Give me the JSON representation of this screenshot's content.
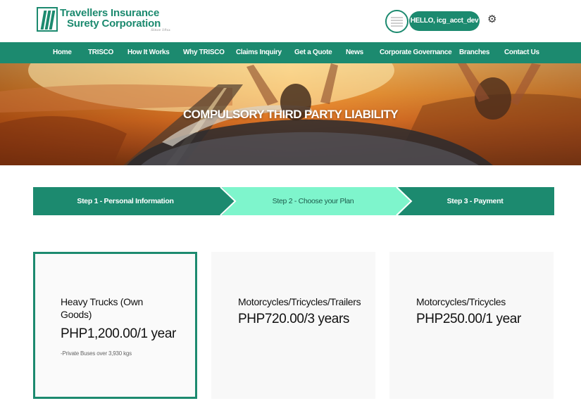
{
  "brand": {
    "name_line1": "Travellers Insurance",
    "name_line2": "Surety Corporation",
    "tagline": "Since 19xx"
  },
  "user": {
    "greeting": "HELLO, icg_acct_dev",
    "settings_icon": "gear-icon"
  },
  "nav": {
    "items": [
      "Home",
      "TRISCO",
      "How It Works",
      "Why TRISCO",
      "Claims Inquiry",
      "Get a Quote",
      "News",
      "Corporate Governance",
      "Branches",
      "Contact Us"
    ]
  },
  "hero": {
    "title": "COMPULSORY THIRD PARTY LIABILITY"
  },
  "steps": [
    {
      "label": "Step 1 - Personal Information",
      "state": "completed"
    },
    {
      "label": "Step 2 - Choose your Plan",
      "state": "active"
    },
    {
      "label": "Step 3 - Payment",
      "state": "upcoming"
    }
  ],
  "plans": [
    {
      "name": "Heavy Trucks (Own Goods)",
      "price": "PHP1,200.00/1 year",
      "note": "-Private Buses over 3,930 kgs",
      "selected": true
    },
    {
      "name": "Motorcycles/Tricycles/Trailers",
      "price": "PHP720.00/3 years",
      "note": "",
      "selected": false
    },
    {
      "name": "Motorcycles/Tricycles",
      "price": "PHP250.00/1 year",
      "note": "",
      "selected": false
    }
  ],
  "colors": {
    "brand_green": "#1c8a6f",
    "active_step_mint": "#7ef5cc"
  }
}
